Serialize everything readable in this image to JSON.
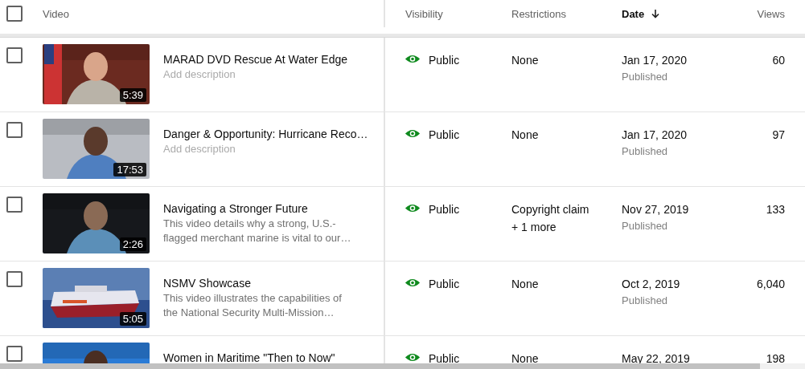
{
  "table": {
    "select_all": {
      "checked": false
    },
    "columns": [
      {
        "label": "Video",
        "sorted": false
      },
      {
        "label": "Visibility",
        "sorted": false
      },
      {
        "label": "Restrictions",
        "sorted": false
      },
      {
        "label": "Date",
        "sorted": true
      },
      {
        "label": "Views",
        "sorted": false
      }
    ],
    "rows": [
      {
        "checked": false,
        "duration": "5:39",
        "title": "MARAD DVD Rescue At Water Edge",
        "placeholder": "Add description",
        "visibility": {
          "kind": "public",
          "label": "Public"
        },
        "restrictions": [
          "None"
        ],
        "date": "Jan 17, 2020",
        "status": "Published",
        "views": "60"
      },
      {
        "checked": false,
        "duration": "17:53",
        "title": "Danger & Opportunity: Hurricane Reco…",
        "placeholder": "Add description",
        "visibility": {
          "kind": "public",
          "label": "Public"
        },
        "restrictions": [
          "None"
        ],
        "date": "Jan 17, 2020",
        "status": "Published",
        "views": "97"
      },
      {
        "checked": false,
        "duration": "2:26",
        "title": "Navigating a Stronger Future",
        "description": "This video details why a strong, U.S.-flagged merchant marine is vital to our…",
        "visibility": {
          "kind": "public",
          "label": "Public"
        },
        "restrictions": [
          "Copyright claim",
          "+ 1 more"
        ],
        "date": "Nov 27, 2019",
        "status": "Published",
        "views": "133"
      },
      {
        "checked": false,
        "duration": "5:05",
        "title": "NSMV Showcase",
        "description": "This video illustrates the capabilities of the National Security Multi-Mission…",
        "visibility": {
          "kind": "public",
          "label": "Public"
        },
        "restrictions": [
          "None"
        ],
        "date": "Oct 2, 2019",
        "status": "Published",
        "views": "6,040"
      },
      {
        "checked": false,
        "title": "Women in Maritime \"Then to Now\"",
        "visibility": {
          "kind": "public",
          "label": "Public"
        },
        "restrictions": [
          "None"
        ],
        "date": "May 22, 2019",
        "views": "198"
      }
    ]
  }
}
